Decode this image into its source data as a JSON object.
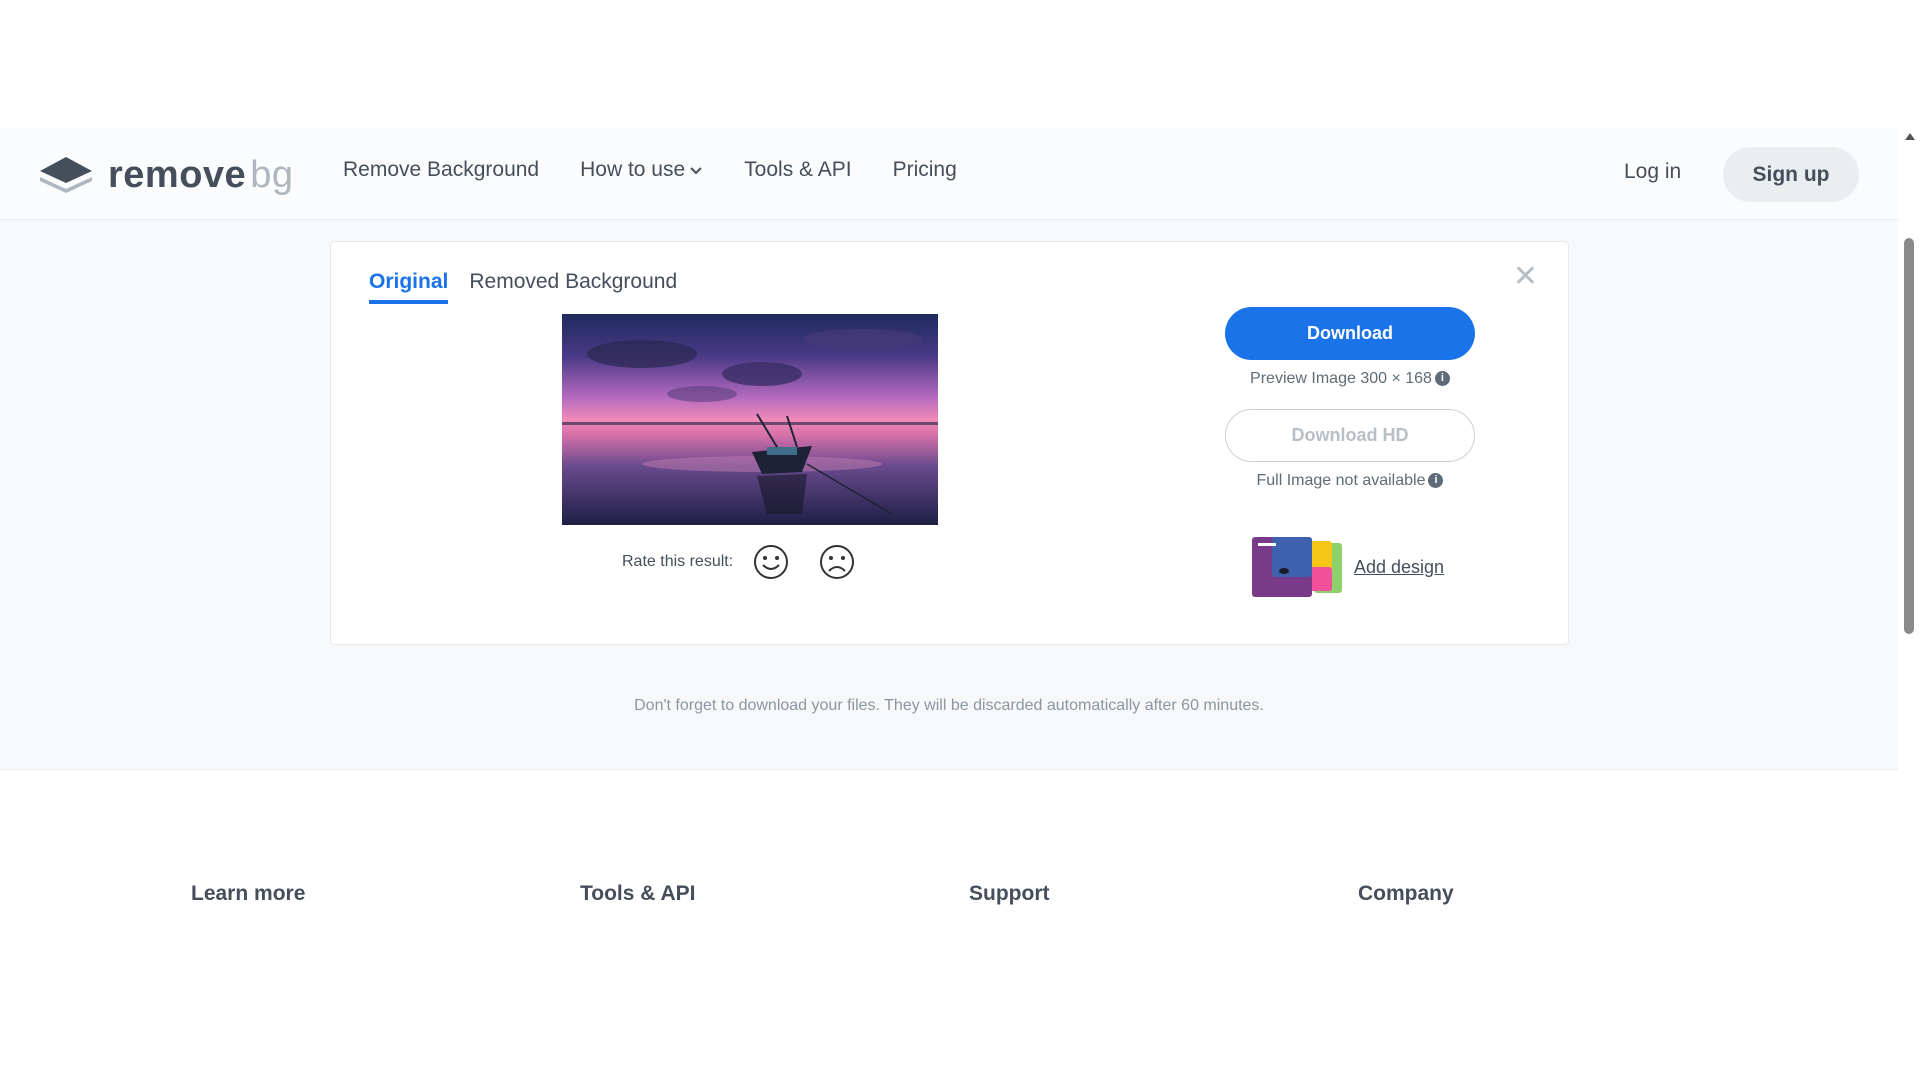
{
  "header": {
    "logo_text": "remove",
    "logo_suffix": "bg",
    "nav": [
      {
        "label": "Remove Background"
      },
      {
        "label": "How to use"
      },
      {
        "label": "Tools & API"
      },
      {
        "label": "Pricing"
      }
    ],
    "login_label": "Log in",
    "signup_label": "Sign up"
  },
  "card": {
    "tabs": [
      {
        "label": "Original",
        "active": true
      },
      {
        "label": "Removed Background",
        "active": false
      }
    ],
    "rate_label": "Rate this result:",
    "download_label": "Download",
    "preview_info": "Preview Image 300 × 168",
    "download_hd_label": "Download HD",
    "full_info": "Full Image not available",
    "add_design_label": "Add design"
  },
  "reminder": "Don't forget to download your files. They will be discarded automatically after 60 minutes.",
  "footer": {
    "columns": [
      "Learn more",
      "Tools & API",
      "Support",
      "Company"
    ]
  },
  "colors": {
    "accent": "#1a73e8",
    "text": "#454f5b",
    "muted": "#8a96a1"
  }
}
